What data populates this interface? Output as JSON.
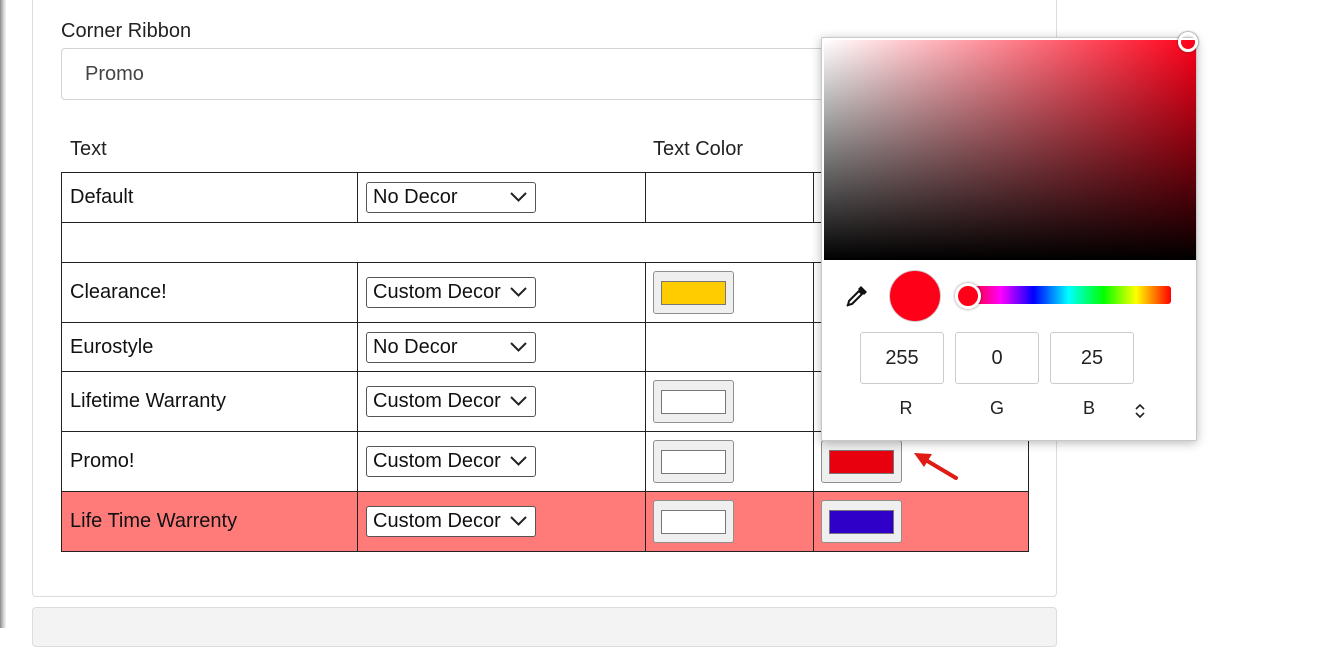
{
  "corner_ribbon": {
    "label": "Corner Ribbon",
    "value": "Promo"
  },
  "table": {
    "headers": {
      "text": "Text",
      "text_color": "Text Color"
    },
    "rows": [
      {
        "text": "Default",
        "decor": "No Decor",
        "text_color": null,
        "bg_color": null
      },
      {
        "text": "Clearance!",
        "decor": "Custom Decor",
        "text_color": "#ffcc00",
        "bg_color": null
      },
      {
        "text": "Eurostyle",
        "decor": "No Decor",
        "text_color": null,
        "bg_color": null
      },
      {
        "text": "Lifetime Warranty",
        "decor": "Custom Decor",
        "text_color": "#ffffff",
        "bg_color": null
      },
      {
        "text": "Promo!",
        "decor": "Custom Decor",
        "text_color": "#ffffff",
        "bg_color": "#e8000f"
      },
      {
        "text": "Life Time Warrenty",
        "decor": "Custom Decor",
        "text_color": "#ffffff",
        "bg_color": "#2f00c8",
        "highlighted": true,
        "highlight_color": "#ff7b79"
      }
    ]
  },
  "color_picker": {
    "current_color": "#ff0019",
    "r": "255",
    "g": "0",
    "b": "25",
    "labels": {
      "r": "R",
      "g": "G",
      "b": "B"
    },
    "icons": {
      "eyedropper": "eyedropper-icon",
      "mode_toggle": "chevron-up-down-icon"
    }
  }
}
